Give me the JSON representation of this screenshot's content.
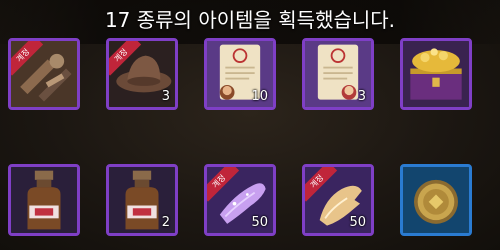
{
  "banner": {
    "message": "17 종류의 아이템을 획득했습니다."
  },
  "items": [
    {
      "name": "hunter-tools-item",
      "rarity": "purple",
      "count": "",
      "tag": "계정"
    },
    {
      "name": "brown-hat-item",
      "rarity": "purple",
      "count": "3",
      "tag": "계정"
    },
    {
      "name": "contract-scroll-item",
      "rarity": "purple",
      "count": "10",
      "tag": ""
    },
    {
      "name": "contract-scroll-item-2",
      "rarity": "purple",
      "count": "3",
      "tag": ""
    },
    {
      "name": "treasure-chest-item",
      "rarity": "purple",
      "count": "",
      "tag": ""
    },
    {
      "name": "potion-bottle-item",
      "rarity": "purple",
      "count": "",
      "tag": ""
    },
    {
      "name": "potion-bottle-item-2",
      "rarity": "purple",
      "count": "2",
      "tag": ""
    },
    {
      "name": "purple-glove-item",
      "rarity": "purple",
      "count": "50",
      "tag": "계정"
    },
    {
      "name": "gold-glove-item",
      "rarity": "purple",
      "count": "50",
      "tag": "계정"
    },
    {
      "name": "gold-coin-item",
      "rarity": "blue",
      "count": "",
      "tag": ""
    }
  ],
  "colors": {
    "purple_frame": "#7f3fc6",
    "blue_frame": "#2a7bd1",
    "account_tag": "#c0253a"
  }
}
